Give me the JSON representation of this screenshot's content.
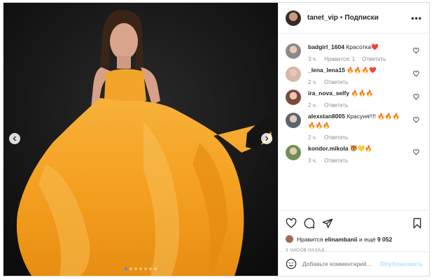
{
  "header": {
    "username": "tanet_vip",
    "separator": "•",
    "follow_label": "Подписки",
    "more_label": "•••"
  },
  "photo": {
    "slide_count": 7,
    "active_slide": 1,
    "dress_color": "#f5a623",
    "background_color": "#121212"
  },
  "comments": [
    {
      "user": "badgirl_1604",
      "text": "Красотка❤️",
      "time": "3 ч.",
      "likes": "Нравится: 1",
      "reply": "Ответить",
      "avatar_color": "#8a8a8a"
    },
    {
      "user": "_lena_lena15",
      "text": "🔥🔥🔥❤️",
      "time": "2 ч.",
      "likes": "",
      "reply": "Ответить",
      "avatar_color": "#d6b8a8"
    },
    {
      "user": "ira_nova_selfy",
      "text": "🔥🔥🔥",
      "time": "2 ч.",
      "likes": "",
      "reply": "Ответить",
      "avatar_color": "#7a4b3a"
    },
    {
      "user": "alexstan8005",
      "text": "Красуня!!!! 🔥🔥🔥 🔥🔥🔥",
      "time": "2 ч.",
      "likes": "",
      "reply": "Ответить",
      "avatar_color": "#5a6470"
    },
    {
      "user": "kondor.mikola",
      "text": "🐯💛🔥",
      "time": "3 ч.",
      "likes": "",
      "reply": "Ответить",
      "avatar_color": "#6f8f55"
    }
  ],
  "actions": {
    "like_icon": "heart-outline-icon",
    "comment_icon": "comment-icon",
    "share_icon": "paper-plane-icon",
    "save_icon": "bookmark-icon"
  },
  "likes": {
    "prefix": "Нравится",
    "user": "elinambanii",
    "middle": "и ещё",
    "count": "9 052"
  },
  "posted": "3 ЧАСОВ НАЗАД",
  "add_comment": {
    "placeholder": "Добавьте комментарий...",
    "post_label": "Опубликовать"
  }
}
